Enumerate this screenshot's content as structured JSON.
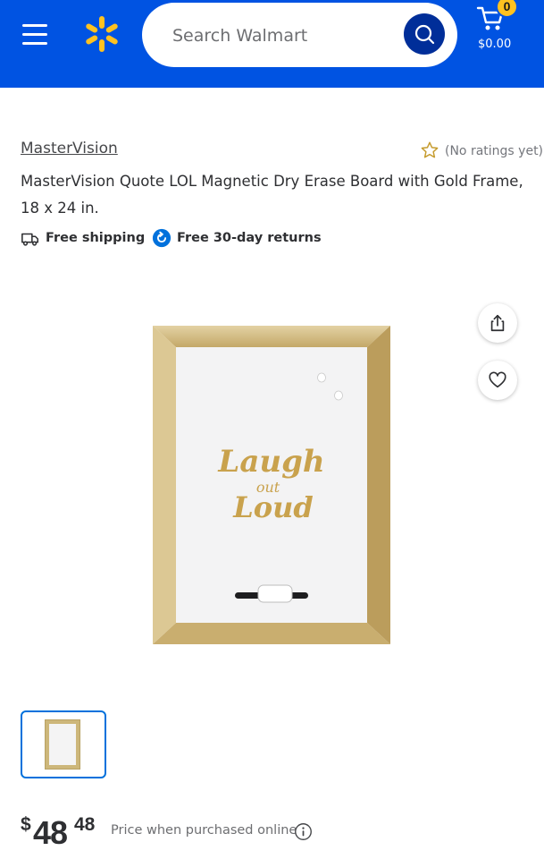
{
  "header": {
    "search": {
      "placeholder": "Search Walmart"
    },
    "cart": {
      "count": "0",
      "total": "$0.00"
    },
    "colors": {
      "brand_blue": "#0053e2",
      "spark_yellow": "#ffc220",
      "search_button": "#002e99"
    }
  },
  "product": {
    "brand": "MasterVision",
    "rating_text": "(No ratings yet)",
    "title": "MasterVision Quote LOL Magnetic Dry Erase Board with Gold Frame, 18 x 24 in.",
    "perks": {
      "shipping": "Free shipping",
      "returns": "Free 30-day returns"
    },
    "image_text": [
      "Laugh",
      "out",
      "Loud"
    ],
    "price": {
      "currency": "$",
      "dollars": "48",
      "cents": "48",
      "note": "Price when purchased online"
    }
  },
  "icons": {
    "menu": "menu-icon",
    "spark": "walmart-spark-logo",
    "search": "search-icon",
    "cart": "cart-icon",
    "star": "star-outline-icon",
    "truck": "truck-icon",
    "returns": "returns-icon",
    "share": "share-icon",
    "favorite": "heart-outline-icon",
    "info": "info-icon"
  }
}
